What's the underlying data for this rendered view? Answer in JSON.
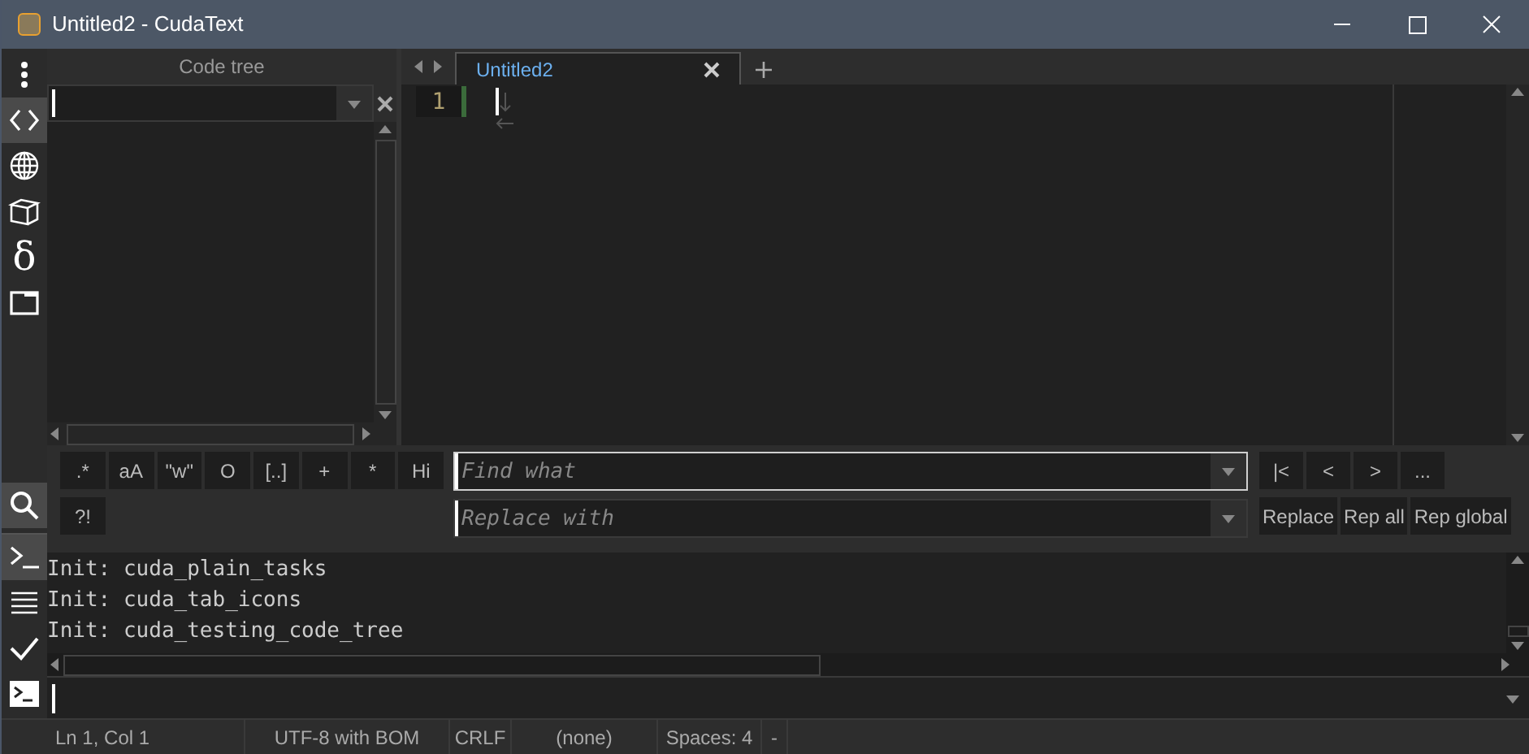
{
  "window": {
    "title": "Untitled2 - CudaText"
  },
  "sidebar_top": [
    {
      "kind": "menu",
      "selected": false
    },
    {
      "kind": "code",
      "selected": true
    },
    {
      "kind": "globe",
      "selected": false
    },
    {
      "kind": "box",
      "selected": false
    },
    {
      "kind": "delta",
      "glyph": "δ",
      "selected": false
    },
    {
      "kind": "window",
      "selected": false
    }
  ],
  "sidebar_bottom": [
    {
      "kind": "search",
      "selected": true
    },
    {
      "kind": "console",
      "selected": true
    },
    {
      "kind": "list",
      "selected": false
    },
    {
      "kind": "check",
      "selected": false
    },
    {
      "kind": "terminal",
      "selected": false
    }
  ],
  "code_tree": {
    "title": "Code tree"
  },
  "tabs": [
    {
      "label": "Untitled2",
      "selected": true
    }
  ],
  "editor": {
    "line_numbers": [
      "1"
    ]
  },
  "find": {
    "options": [
      ".*",
      "aA",
      "\"w\"",
      "O",
      "[..]",
      "+",
      "*",
      "Hi"
    ],
    "options_row2": [
      "?!"
    ],
    "find_placeholder": "Find what",
    "replace_placeholder": "Replace with",
    "nav_buttons": [
      "|<",
      "<",
      ">",
      "..."
    ],
    "replace_buttons": [
      "Replace",
      "Rep all",
      "Rep global"
    ]
  },
  "output": {
    "lines": [
      "Init: cuda_plain_tasks",
      "Init: cuda_tab_icons",
      "Init: cuda_testing_code_tree"
    ]
  },
  "status_bar": [
    "Ln 1, Col 1",
    "UTF-8 with BOM",
    "CRLF",
    "(none)",
    "Spaces: 4",
    "-"
  ]
}
